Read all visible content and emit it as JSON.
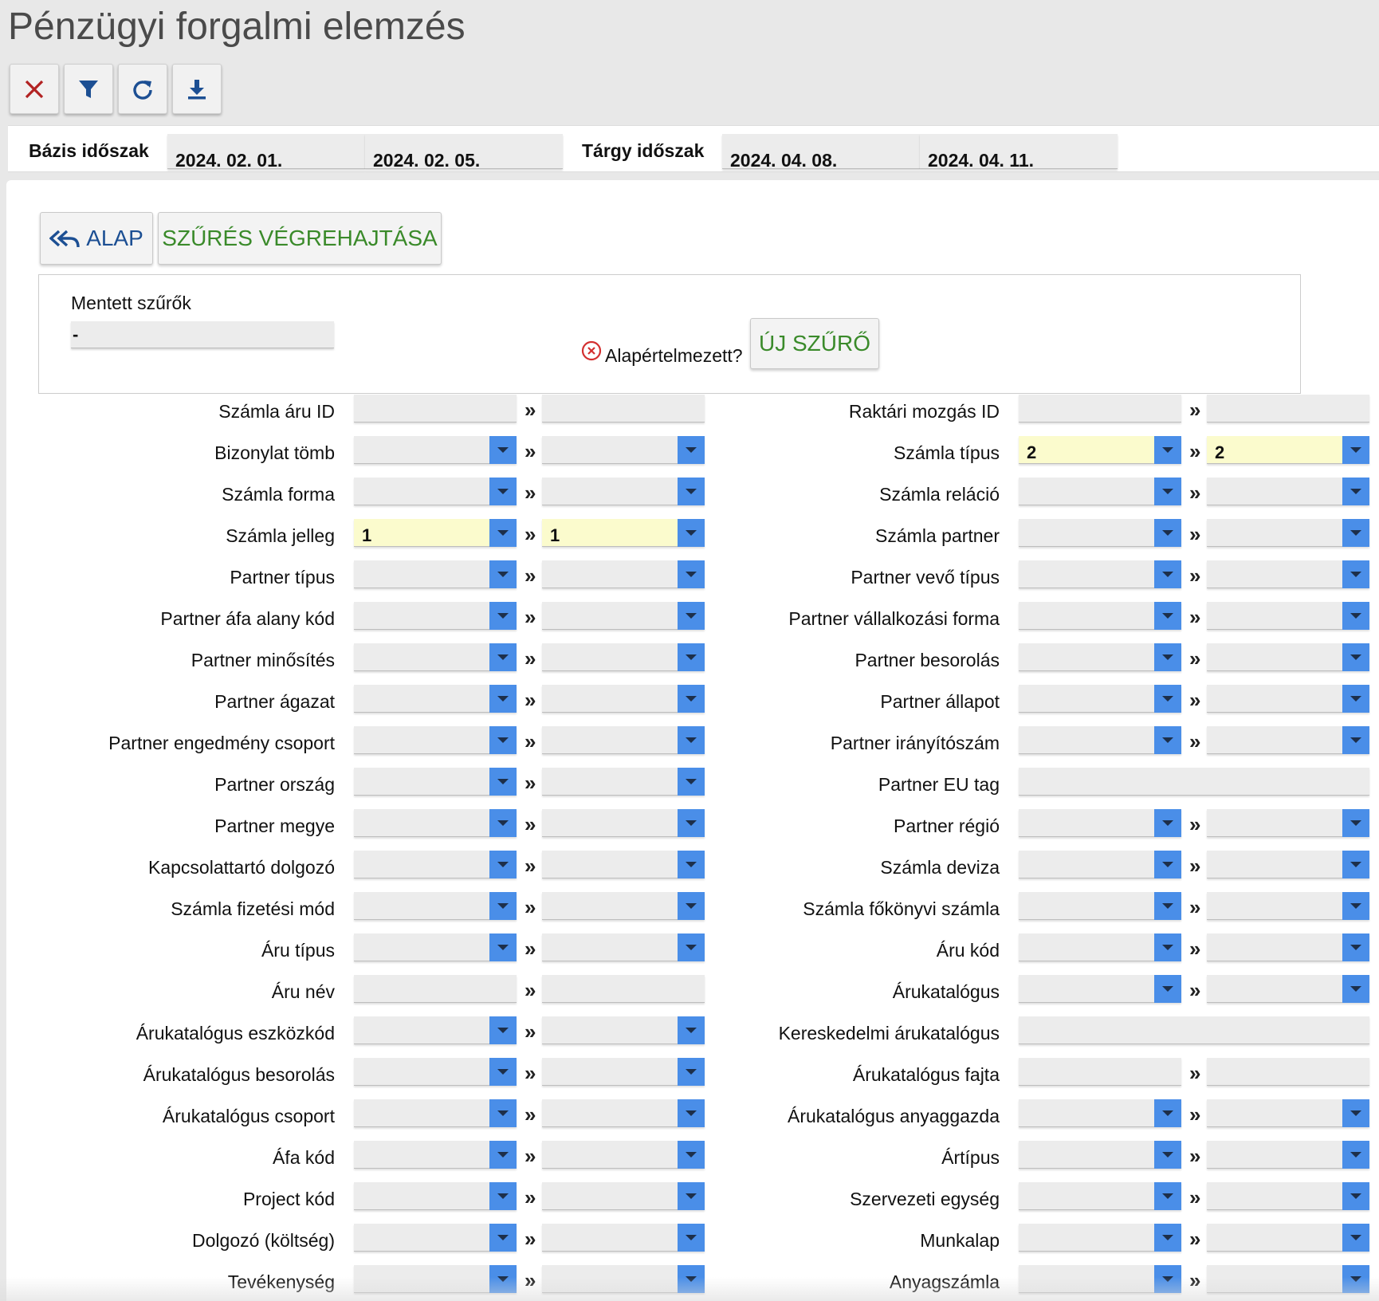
{
  "page_title": "Pénzügyi forgalmi elemzés",
  "toolbar": {
    "icons": [
      "close-icon",
      "filter-icon",
      "refresh-icon",
      "download-icon"
    ],
    "colors": {
      "close": "#b22222",
      "others": "#1c4f93"
    }
  },
  "periods": {
    "base_label": "Bázis időszak",
    "base_from": "2024. 02. 01.",
    "base_to": "2024. 02. 05.",
    "target_label": "Tárgy időszak",
    "target_from": "2024. 04. 08.",
    "target_to": "2024. 04. 11."
  },
  "buttons": {
    "alap": "ALAP",
    "execute": "SZŰRÉS VÉGREHAJTÁSA",
    "new_filter": "ÚJ SZŰRŐ"
  },
  "saved_filters": {
    "label": "Mentett szűrők",
    "value": "-",
    "default_label": "Alapértelmezett?"
  },
  "separator": "»",
  "left_fields": [
    {
      "label": "Számla áru ID",
      "type": "text",
      "from": "",
      "to": ""
    },
    {
      "label": "Bizonylat tömb",
      "type": "select",
      "from": "",
      "to": ""
    },
    {
      "label": "Számla forma",
      "type": "select",
      "from": "",
      "to": ""
    },
    {
      "label": "Számla jelleg",
      "type": "select",
      "from": "1",
      "to": "1",
      "highlight": true
    },
    {
      "label": "Partner típus",
      "type": "select",
      "from": "",
      "to": ""
    },
    {
      "label": "Partner áfa alany kód",
      "type": "select",
      "from": "",
      "to": ""
    },
    {
      "label": "Partner minősítés",
      "type": "select",
      "from": "",
      "to": ""
    },
    {
      "label": "Partner ágazat",
      "type": "select",
      "from": "",
      "to": ""
    },
    {
      "label": "Partner engedmény csoport",
      "type": "select",
      "from": "",
      "to": ""
    },
    {
      "label": "Partner ország",
      "type": "select",
      "from": "",
      "to": ""
    },
    {
      "label": "Partner megye",
      "type": "select",
      "from": "",
      "to": ""
    },
    {
      "label": "Kapcsolattartó dolgozó",
      "type": "select",
      "from": "",
      "to": ""
    },
    {
      "label": "Számla fizetési mód",
      "type": "select",
      "from": "",
      "to": ""
    },
    {
      "label": "Áru típus",
      "type": "select",
      "from": "",
      "to": ""
    },
    {
      "label": "Áru név",
      "type": "text",
      "from": "",
      "to": ""
    },
    {
      "label": "Árukatalógus eszközkód",
      "type": "select",
      "from": "",
      "to": ""
    },
    {
      "label": "Árukatalógus besorolás",
      "type": "select",
      "from": "",
      "to": ""
    },
    {
      "label": "Árukatalógus csoport",
      "type": "select",
      "from": "",
      "to": ""
    },
    {
      "label": "Áfa kód",
      "type": "select",
      "from": "",
      "to": ""
    },
    {
      "label": "Project kód",
      "type": "select",
      "from": "",
      "to": ""
    },
    {
      "label": "Dolgozó (költség)",
      "type": "select",
      "from": "",
      "to": ""
    },
    {
      "label": "Tevékenység",
      "type": "select",
      "from": "",
      "to": ""
    }
  ],
  "right_fields": [
    {
      "label": "Raktári mozgás ID",
      "type": "text",
      "from": "",
      "to": ""
    },
    {
      "label": "Számla típus",
      "type": "select",
      "from": "2",
      "to": "2",
      "highlight": true
    },
    {
      "label": "Számla reláció",
      "type": "select",
      "from": "",
      "to": ""
    },
    {
      "label": "Számla partner",
      "type": "select",
      "from": "",
      "to": ""
    },
    {
      "label": "Partner vevő típus",
      "type": "select",
      "from": "",
      "to": ""
    },
    {
      "label": "Partner vállalkozási forma",
      "type": "select",
      "from": "",
      "to": ""
    },
    {
      "label": "Partner besorolás",
      "type": "select",
      "from": "",
      "to": ""
    },
    {
      "label": "Partner állapot",
      "type": "select",
      "from": "",
      "to": ""
    },
    {
      "label": "Partner irányítószám",
      "type": "select",
      "from": "",
      "to": ""
    },
    {
      "label": "Partner EU tag",
      "type": "single",
      "from": ""
    },
    {
      "label": "Partner régió",
      "type": "select",
      "from": "",
      "to": ""
    },
    {
      "label": "Számla deviza",
      "type": "select",
      "from": "",
      "to": ""
    },
    {
      "label": "Számla főkönyvi számla",
      "type": "select",
      "from": "",
      "to": ""
    },
    {
      "label": "Áru kód",
      "type": "select",
      "from": "",
      "to": ""
    },
    {
      "label": "Árukatalógus",
      "type": "select",
      "from": "",
      "to": ""
    },
    {
      "label": "Kereskedelmi árukatalógus",
      "type": "single",
      "from": ""
    },
    {
      "label": "Árukatalógus fajta",
      "type": "text",
      "from": "",
      "to": ""
    },
    {
      "label": "Árukatalógus anyaggazda",
      "type": "select",
      "from": "",
      "to": ""
    },
    {
      "label": "Ártípus",
      "type": "select",
      "from": "",
      "to": ""
    },
    {
      "label": "Szervezeti egység",
      "type": "select",
      "from": "",
      "to": ""
    },
    {
      "label": "Munkalap",
      "type": "select",
      "from": "",
      "to": ""
    },
    {
      "label": "Anyagszámla",
      "type": "select",
      "from": "",
      "to": ""
    }
  ]
}
